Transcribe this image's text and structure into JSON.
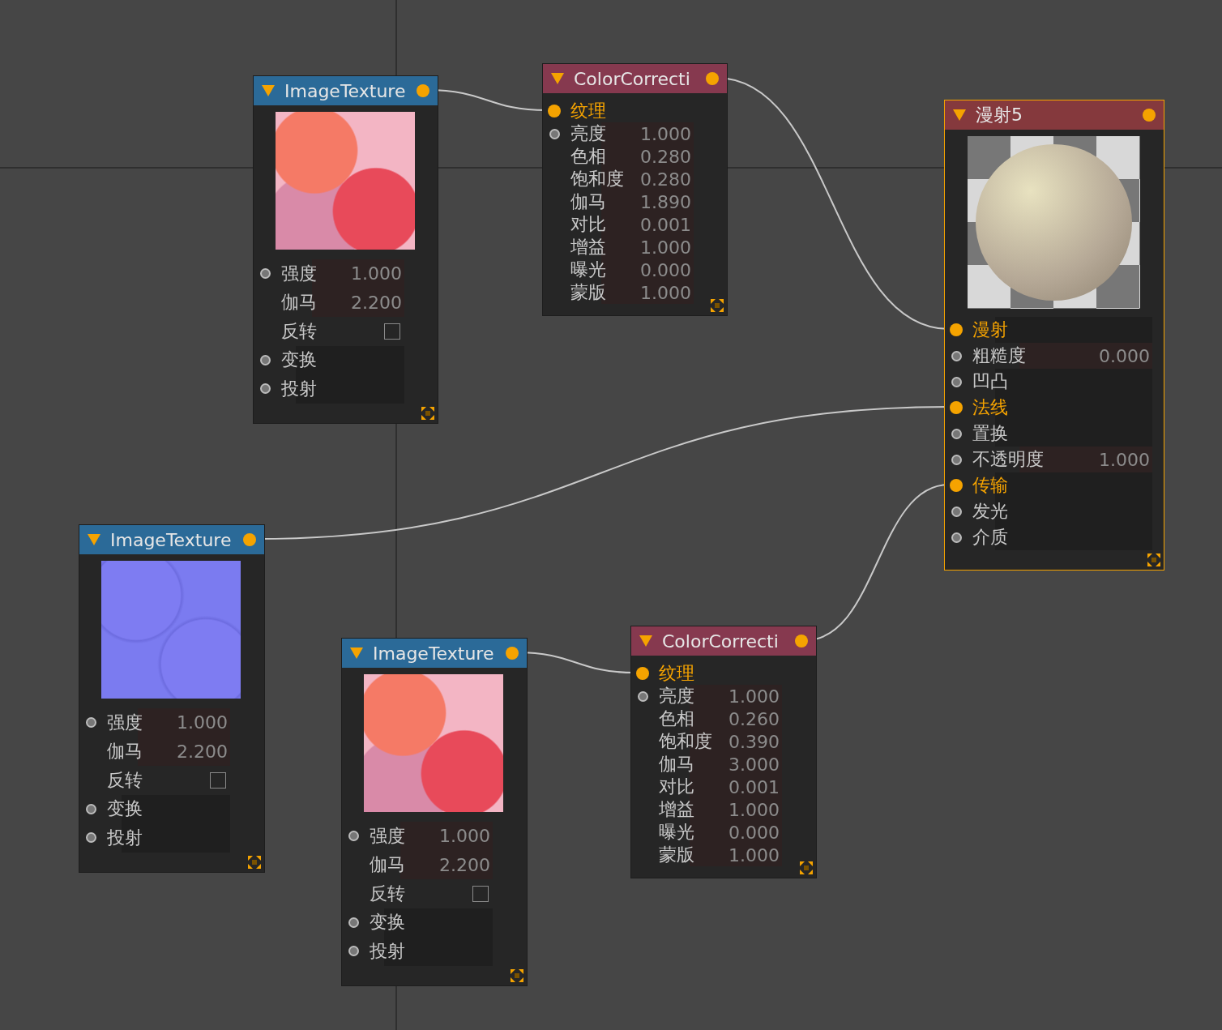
{
  "nodes": [
    {
      "kind": "image-texture",
      "title": "ImageTexture",
      "expanded": true,
      "selected": false,
      "preview": {
        "kind": "color-texture"
      },
      "rows": [
        {
          "label": "强度",
          "kind": "value",
          "value": "1.000",
          "port": true,
          "linked": false
        },
        {
          "label": "伽马",
          "kind": "value",
          "value": "2.200",
          "port": false,
          "linked": false
        },
        {
          "label": "反转",
          "kind": "checkbox",
          "checked": false,
          "port": false,
          "linked": false
        },
        {
          "label": "变换",
          "kind": "input",
          "port": true,
          "linked": false
        },
        {
          "label": "投射",
          "kind": "input",
          "port": true,
          "linked": false
        }
      ]
    },
    {
      "kind": "color-correction",
      "title": "ColorCorrecti",
      "expanded": true,
      "selected": false,
      "rows": [
        {
          "label": "纹理",
          "kind": "link",
          "port": true,
          "linked": true
        },
        {
          "label": "亮度",
          "kind": "value",
          "value": "1.000",
          "port": true,
          "linked": false
        },
        {
          "label": "色相",
          "kind": "value",
          "value": "0.280",
          "port": false,
          "linked": false
        },
        {
          "label": "饱和度",
          "kind": "value",
          "value": "0.280",
          "port": false,
          "linked": false
        },
        {
          "label": "伽马",
          "kind": "value",
          "value": "1.890",
          "port": false,
          "linked": false
        },
        {
          "label": "对比",
          "kind": "value",
          "value": "0.001",
          "port": false,
          "linked": false
        },
        {
          "label": "增益",
          "kind": "value",
          "value": "1.000",
          "port": false,
          "linked": false
        },
        {
          "label": "曝光",
          "kind": "value",
          "value": "0.000",
          "port": false,
          "linked": false
        },
        {
          "label": "蒙版",
          "kind": "value",
          "value": "1.000",
          "port": false,
          "linked": false
        }
      ]
    },
    {
      "kind": "material",
      "title": "漫射5",
      "expanded": true,
      "selected": true,
      "preview": {
        "kind": "sphere"
      },
      "rows": [
        {
          "label": "漫射",
          "kind": "input",
          "port": true,
          "linked": true
        },
        {
          "label": "粗糙度",
          "kind": "value",
          "value": "0.000",
          "port": true,
          "linked": false
        },
        {
          "label": "凹凸",
          "kind": "input",
          "port": true,
          "linked": false
        },
        {
          "label": "法线",
          "kind": "input",
          "port": true,
          "linked": true
        },
        {
          "label": "置换",
          "kind": "input",
          "port": true,
          "linked": false
        },
        {
          "label": "不透明度",
          "kind": "value",
          "value": "1.000",
          "port": true,
          "linked": false
        },
        {
          "label": "传输",
          "kind": "input",
          "port": true,
          "linked": true
        },
        {
          "label": "发光",
          "kind": "input",
          "port": true,
          "linked": false
        },
        {
          "label": "介质",
          "kind": "input",
          "port": true,
          "linked": false
        }
      ]
    },
    {
      "kind": "image-texture",
      "title": "ImageTexture",
      "expanded": true,
      "selected": false,
      "preview": {
        "kind": "normal-texture"
      },
      "rows": [
        {
          "label": "强度",
          "kind": "value",
          "value": "1.000",
          "port": true,
          "linked": false
        },
        {
          "label": "伽马",
          "kind": "value",
          "value": "2.200",
          "port": false,
          "linked": false
        },
        {
          "label": "反转",
          "kind": "checkbox",
          "checked": false,
          "port": false,
          "linked": false
        },
        {
          "label": "变换",
          "kind": "input",
          "port": true,
          "linked": false
        },
        {
          "label": "投射",
          "kind": "input",
          "port": true,
          "linked": false
        }
      ]
    },
    {
      "kind": "image-texture",
      "title": "ImageTexture",
      "expanded": true,
      "selected": false,
      "preview": {
        "kind": "color-texture"
      },
      "rows": [
        {
          "label": "强度",
          "kind": "value",
          "value": "1.000",
          "port": true,
          "linked": false
        },
        {
          "label": "伽马",
          "kind": "value",
          "value": "2.200",
          "port": false,
          "linked": false
        },
        {
          "label": "反转",
          "kind": "checkbox",
          "checked": false,
          "port": false,
          "linked": false
        },
        {
          "label": "变换",
          "kind": "input",
          "port": true,
          "linked": false
        },
        {
          "label": "投射",
          "kind": "input",
          "port": true,
          "linked": false
        }
      ]
    },
    {
      "kind": "color-correction",
      "title": "ColorCorrecti",
      "expanded": true,
      "selected": false,
      "rows": [
        {
          "label": "纹理",
          "kind": "link",
          "port": true,
          "linked": true
        },
        {
          "label": "亮度",
          "kind": "value",
          "value": "1.000",
          "port": true,
          "linked": false
        },
        {
          "label": "色相",
          "kind": "value",
          "value": "0.260",
          "port": false,
          "linked": false
        },
        {
          "label": "饱和度",
          "kind": "value",
          "value": "0.390",
          "port": false,
          "linked": false
        },
        {
          "label": "伽马",
          "kind": "value",
          "value": "3.000",
          "port": false,
          "linked": false
        },
        {
          "label": "对比",
          "kind": "value",
          "value": "0.001",
          "port": false,
          "linked": false
        },
        {
          "label": "增益",
          "kind": "value",
          "value": "1.000",
          "port": false,
          "linked": false
        },
        {
          "label": "曝光",
          "kind": "value",
          "value": "0.000",
          "port": false,
          "linked": false
        },
        {
          "label": "蒙版",
          "kind": "value",
          "value": "1.000",
          "port": false,
          "linked": false
        }
      ]
    }
  ]
}
